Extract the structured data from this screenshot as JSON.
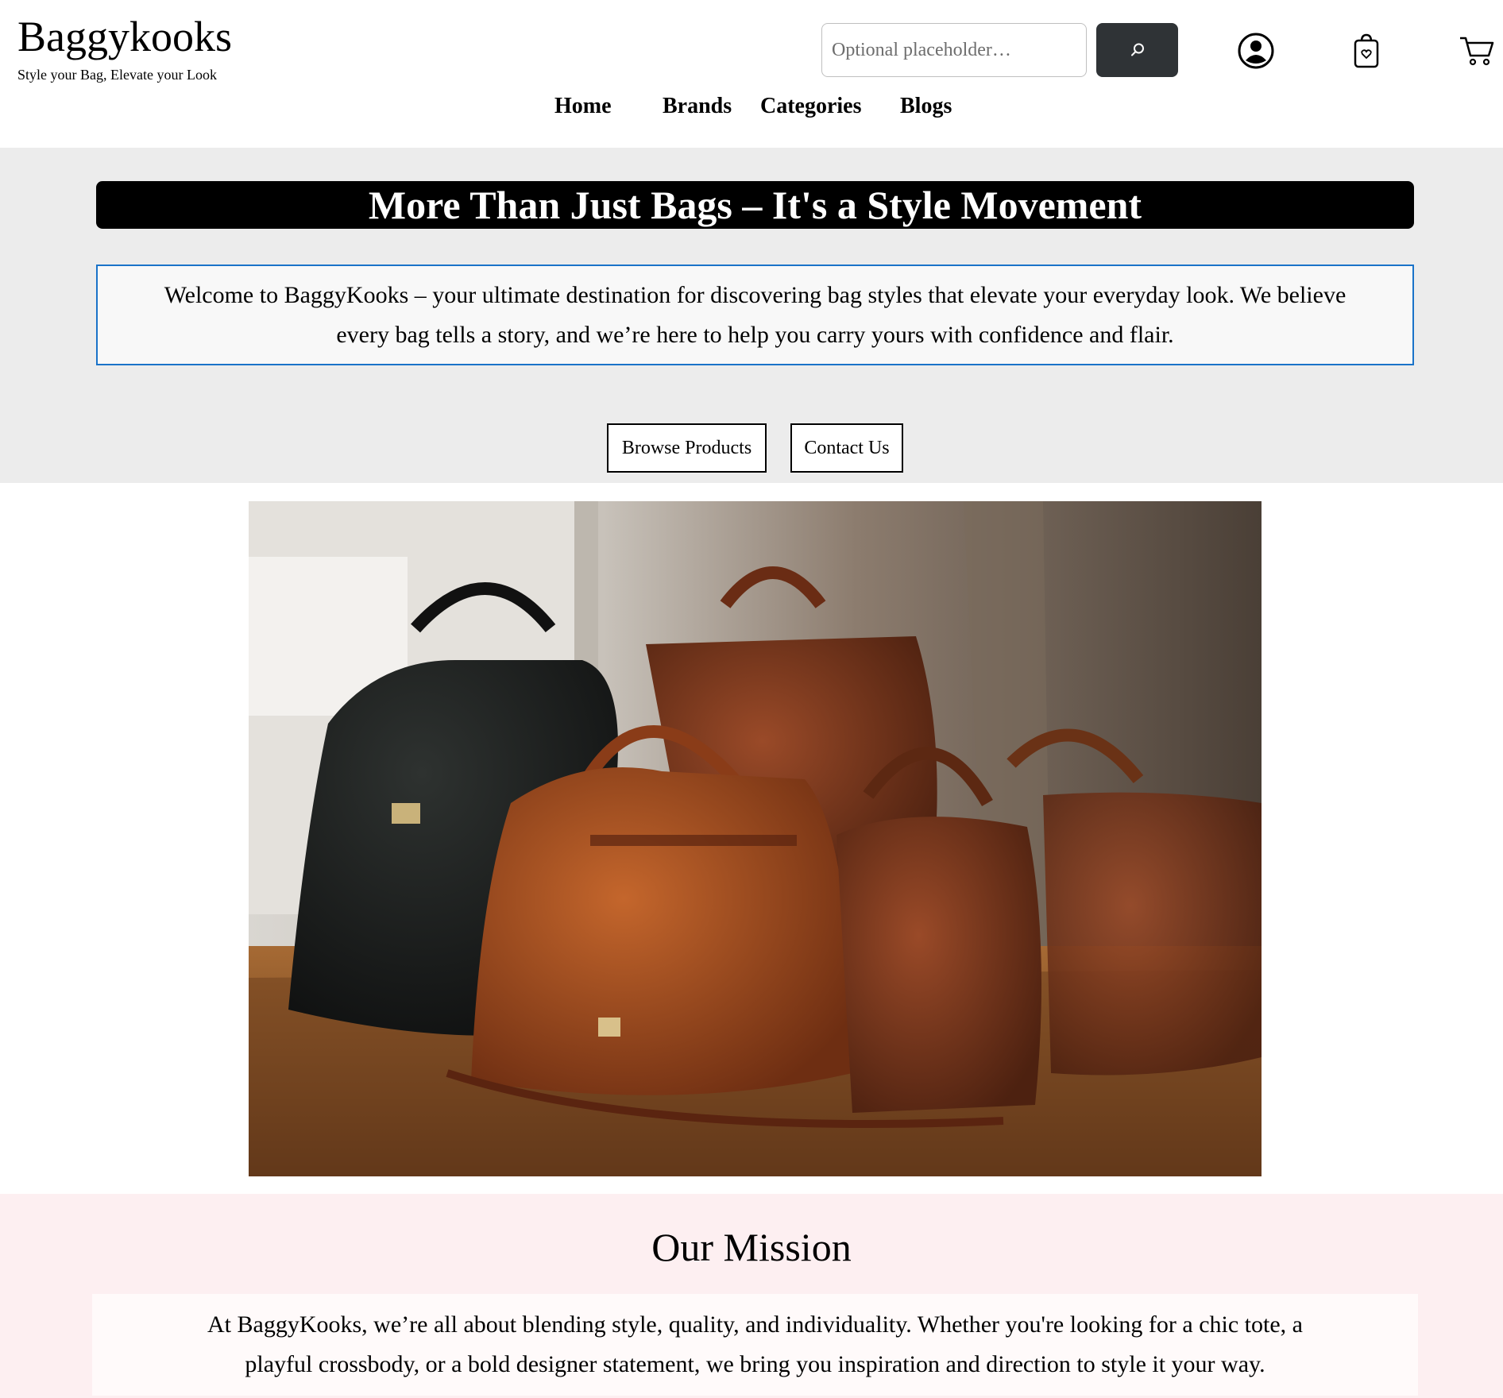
{
  "header": {
    "brand_title": "Baggykooks",
    "brand_tagline": "Style your Bag, Elevate your Look",
    "search": {
      "placeholder": "Optional placeholder…",
      "value": ""
    },
    "icons": [
      "search-icon",
      "account-icon",
      "wishlist-bag-icon",
      "cart-icon"
    ]
  },
  "nav": {
    "items": [
      {
        "label": "Home"
      },
      {
        "label": "Brands"
      },
      {
        "label": "Categories"
      },
      {
        "label": "Blogs"
      }
    ]
  },
  "hero": {
    "banner": "More Than Just Bags – It's a Style Movement",
    "intro": "Welcome to BaggyKooks – your ultimate destination for discovering bag styles that elevate your everyday look. We believe every bag tells a story, and we’re here to help you carry yours with confidence and flair.",
    "buttons": {
      "browse": "Browse Products",
      "contact": "Contact Us"
    }
  },
  "mission": {
    "title": "Our Mission",
    "text": "At BaggyKooks, we’re all about blending style, quality, and individuality. Whether you're looking for a chic tote, a playful crossbody, or a bold designer statement, we bring you inspiration and direction to style it your way."
  },
  "colors": {
    "accent": "#d32f2f",
    "search_button": "#2f3336",
    "hero_bg": "#ececec",
    "intro_border": "#1a73c9",
    "mission_bg": "#fdeff1"
  }
}
